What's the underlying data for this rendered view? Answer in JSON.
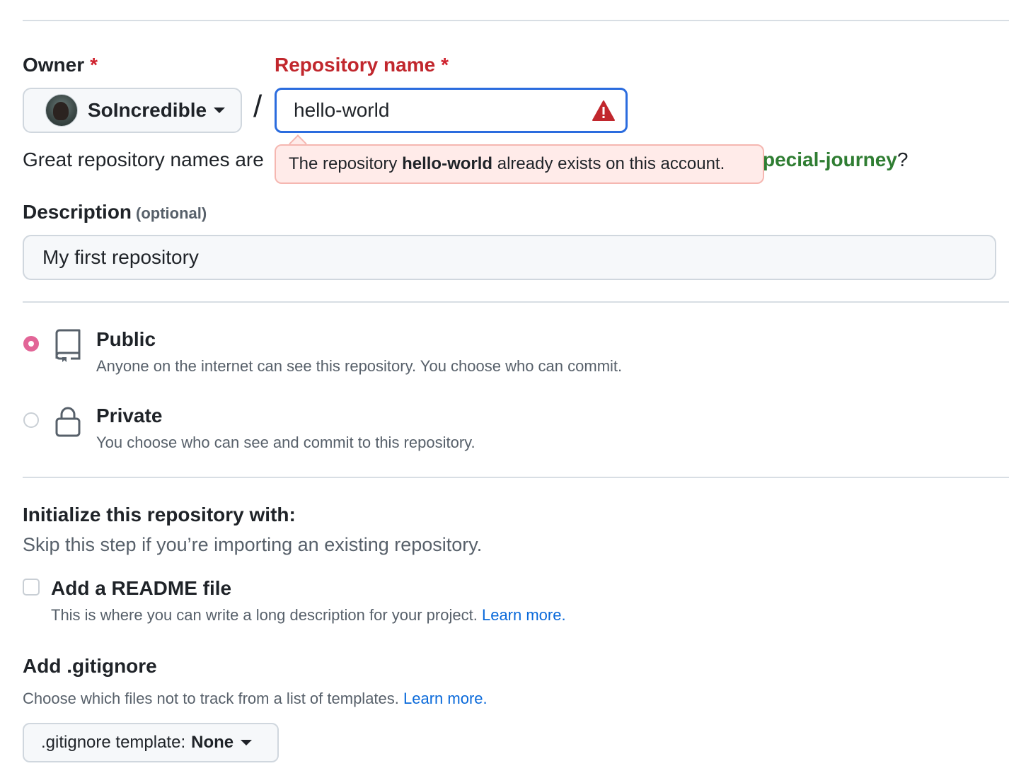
{
  "owner": {
    "label": "Owner",
    "required_mark": "*",
    "selected": "SoIncredible"
  },
  "separator": "/",
  "repo_name": {
    "label": "Repository name",
    "required_mark": "*",
    "value": "hello-world",
    "error_prefix": "The repository ",
    "error_name": "hello-world",
    "error_suffix": " already exists on this account."
  },
  "hint": {
    "text": "Great repository names are",
    "suggestion_visible": "pecial-journey",
    "suffix": "?"
  },
  "description": {
    "label": "Description",
    "optional": "(optional)",
    "value": "My first repository"
  },
  "visibility": {
    "options": [
      {
        "title": "Public",
        "desc": "Anyone on the internet can see this repository. You choose who can commit.",
        "selected": true
      },
      {
        "title": "Private",
        "desc": "You choose who can see and commit to this repository.",
        "selected": false
      }
    ]
  },
  "initialize": {
    "title": "Initialize this repository with:",
    "subtitle": "Skip this step if you’re importing an existing repository.",
    "readme": {
      "label": "Add a README file",
      "desc": "This is where you can write a long description for your project.",
      "link": "Learn more.",
      "checked": false
    }
  },
  "gitignore": {
    "title": "Add .gitignore",
    "desc": "Choose which files not to track from a list of templates.",
    "link": "Learn more.",
    "button_prefix": ".gitignore template:",
    "button_value": "None"
  },
  "colors": {
    "error": "#c1272d",
    "focus": "#2b6cde",
    "radio_selected": "#e26597",
    "link": "#0969da",
    "suggestion": "#2f7d32"
  }
}
